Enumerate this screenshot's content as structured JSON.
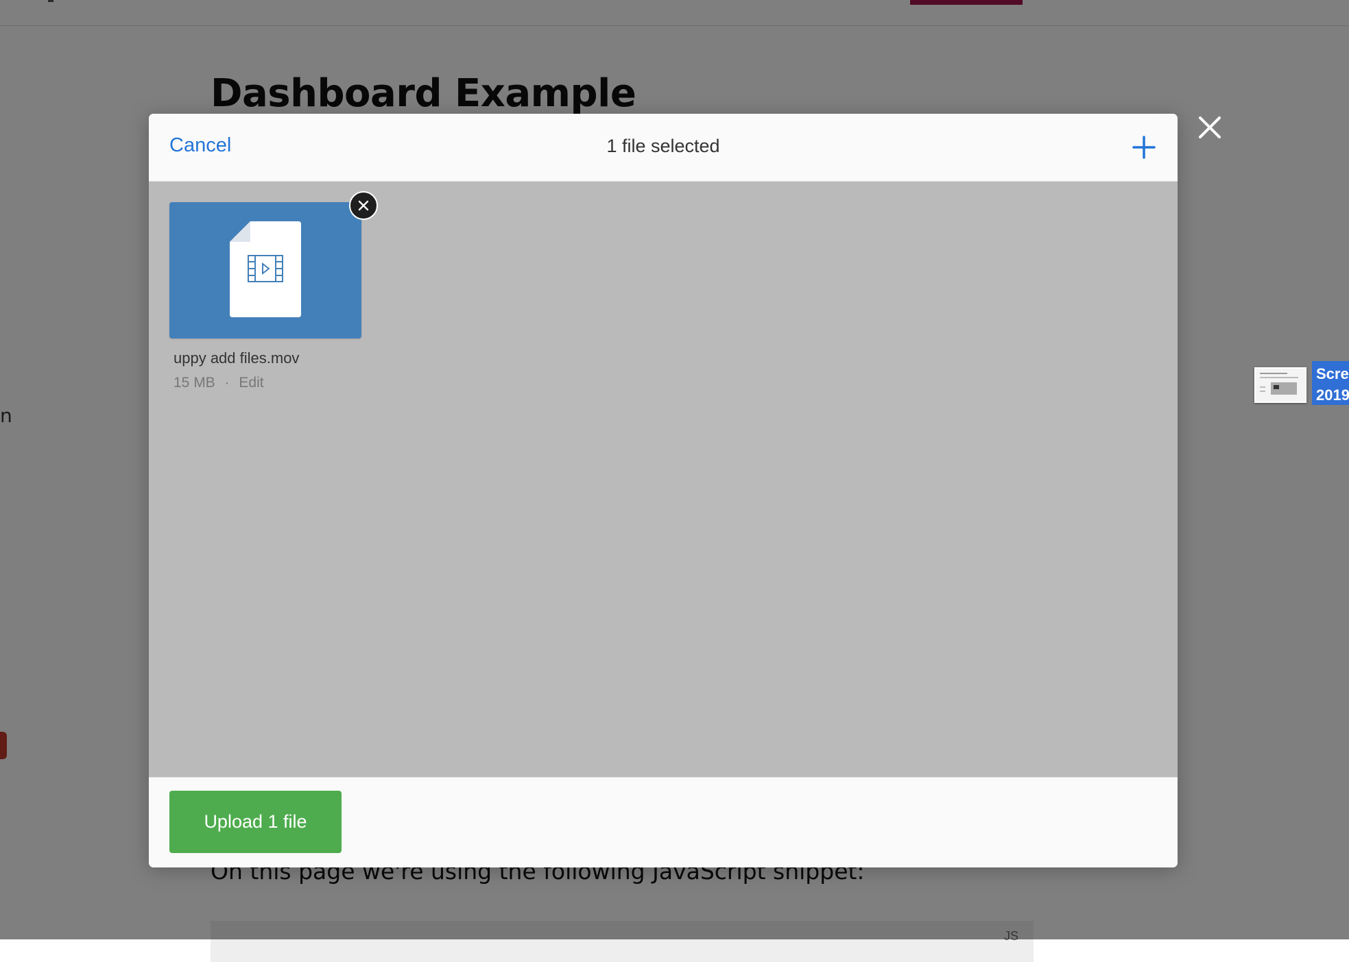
{
  "background": {
    "page_title": "Dashboard Example",
    "side_text": "n",
    "paragraph": "On this page we're using the following JavaScript snippet:",
    "code_lang": "JS"
  },
  "dashboard": {
    "header": {
      "cancel_label": "Cancel",
      "title": "1 file selected",
      "add_more_icon": "plus-icon"
    },
    "files": [
      {
        "name": "uppy add files.mov",
        "size": "15 MB",
        "separator": "·",
        "edit_label": "Edit",
        "type_icon": "video-file-icon"
      }
    ],
    "footer": {
      "upload_label": "Upload 1 file"
    },
    "close_icon": "close-icon"
  },
  "drag_ghost": {
    "label_line1": "Scre",
    "label_line2": "2019"
  },
  "colors": {
    "accent_blue": "#2275d7",
    "file_preview_bg": "#4380b9",
    "upload_green": "#4eac4e",
    "overlay": "rgba(0,0,0,0.5)",
    "nav_active": "#a3174d"
  }
}
